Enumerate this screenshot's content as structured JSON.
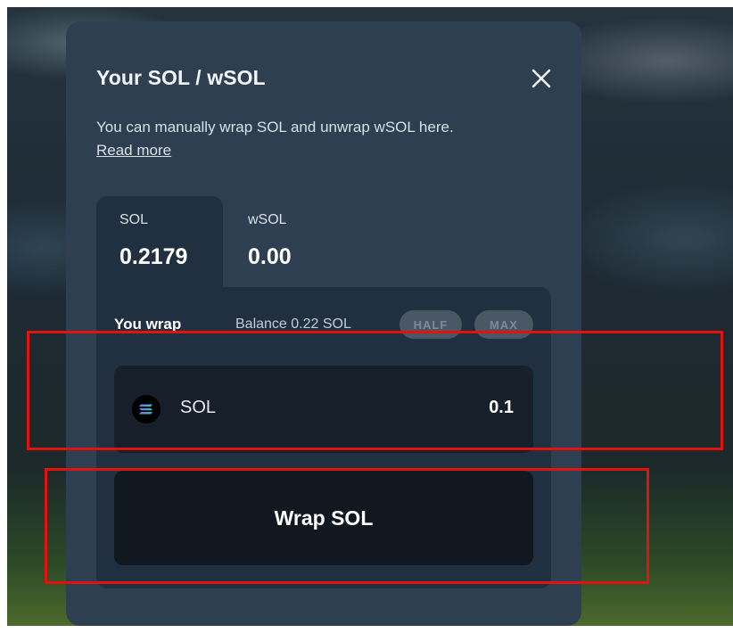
{
  "modal": {
    "title": "Your SOL / wSOL",
    "description": "You can manually wrap SOL and unwrap wSOL here.",
    "read_more": "Read more"
  },
  "tabs": [
    {
      "label": "SOL",
      "value": "0.2179",
      "active": true
    },
    {
      "label": "wSOL",
      "value": "0.00",
      "active": false
    }
  ],
  "wrap": {
    "you_wrap_label": "You wrap",
    "balance_text": "Balance 0.22 SOL",
    "half_label": "HALF",
    "max_label": "MAX",
    "token": "SOL",
    "amount": "0.1",
    "button_label": "Wrap SOL"
  },
  "colors": {
    "highlight": "#e2120f",
    "modal_bg": "#2d3f51",
    "panel_bg": "#213040",
    "input_bg": "#17202a",
    "button_bg": "#121820"
  },
  "icons": {
    "close": "close-icon",
    "token": "solana-icon"
  }
}
